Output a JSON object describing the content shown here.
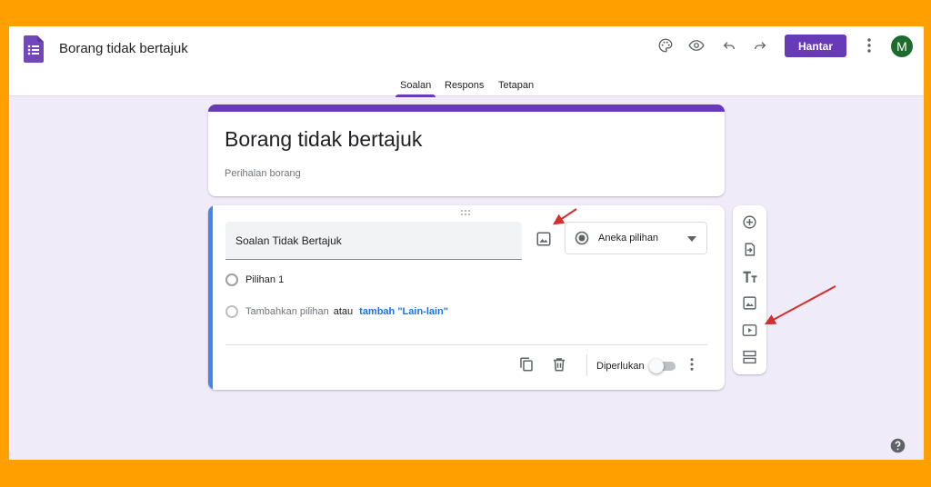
{
  "header": {
    "doc_title": "Borang tidak bertajuk",
    "send_label": "Hantar",
    "avatar_letter": "M",
    "icons": [
      "palette-icon",
      "eye-icon",
      "undo-icon",
      "redo-icon",
      "more-vert-icon"
    ]
  },
  "tabs": [
    {
      "label": "Soalan",
      "active": true
    },
    {
      "label": "Respons",
      "active": false
    },
    {
      "label": "Tetapan",
      "active": false
    }
  ],
  "form": {
    "title": "Borang tidak bertajuk",
    "description_placeholder": "Perihalan borang"
  },
  "question": {
    "title": "Soalan Tidak Bertajuk",
    "type": "Aneka pilihan",
    "options": [
      "Pilihan 1"
    ],
    "add_option": "Tambahkan pilihan",
    "or_text": "atau",
    "add_other": "tambah \"Lain-lain\"",
    "required_label": "Diperlukan",
    "required_on": false
  },
  "side_toolbar": [
    "add-question-icon",
    "import-questions-icon",
    "add-title-icon",
    "add-image-icon",
    "add-video-icon",
    "add-section-icon"
  ],
  "colors": {
    "accent": "#673ab7",
    "background": "#f0ebf8",
    "frame": "#ff9f00",
    "active_bar": "#4285f4",
    "avatar": "#1e6b2e",
    "annotation_arrow": "#d32f2f"
  }
}
